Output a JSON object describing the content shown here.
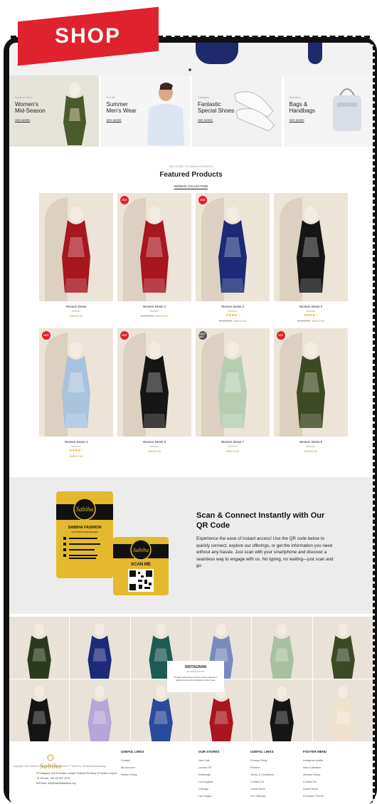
{
  "tag": {
    "label": "SHOP"
  },
  "categories": [
    {
      "subtitle": "Summer New",
      "title_l1": "Women's",
      "title_l2": "Mid-Season",
      "link": "SEE MORE"
    },
    {
      "subtitle": "Hot list",
      "title_l1": "Summer",
      "title_l2": "Men's Wear",
      "link": "SEE MORE"
    },
    {
      "subtitle": "Category",
      "title_l1": "Fantastic",
      "title_l2": "Special Shoes",
      "link": "SEE MORE"
    },
    {
      "subtitle": "Women's",
      "title_l1": "Bags &",
      "title_l2": "Handbags",
      "link": "SEE MORE"
    }
  ],
  "featured": {
    "welcome": "WELCOME TO SABIHA FASHION",
    "title": "Featured Products",
    "tab": "WOMAN COLLECTION"
  },
  "products": [
    {
      "name": "Women Dress",
      "category": "Women",
      "old_price": "",
      "price": "RM415.00",
      "stars": "",
      "badge": "",
      "color": "#a8161e"
    },
    {
      "name": "Women Dress 1",
      "category": "Women",
      "old_price": "RM510.00",
      "price": "RM415.00",
      "stars": "",
      "badge": "HOT",
      "color": "#a8161e"
    },
    {
      "name": "Women Dress 2",
      "category": "Women",
      "old_price": "RM510.00",
      "price": "RM415.00",
      "stars": "★★★★☆",
      "badge": "HOT",
      "color": "#1c2a78"
    },
    {
      "name": "Women Dress 3",
      "category": "Women",
      "old_price": "RM510.00",
      "price": "RM415.00",
      "stars": "★★★★☆",
      "badge": "",
      "color": "#151515"
    },
    {
      "name": "Women Dress 4",
      "category": "Women",
      "old_price": "",
      "price": "RM510.00",
      "stars": "★★★★☆",
      "badge": "HOT",
      "color": "#a9c2dd"
    },
    {
      "name": "Women Dress 6",
      "category": "Women",
      "old_price": "",
      "price": "RM415.00",
      "stars": "",
      "badge": "HOT",
      "color": "#151515"
    },
    {
      "name": "Women Dress 7",
      "category": "Women",
      "old_price": "",
      "price": "RM373.00",
      "stars": "",
      "badge": "SOLD OUT",
      "color": "#b6cdb2"
    },
    {
      "name": "Women Dress 8",
      "category": "Women",
      "old_price": "",
      "price": "RM438.00",
      "stars": "",
      "badge": "HOT",
      "color": "#3d4a24"
    }
  ],
  "qr": {
    "title": "Scan & Connect Instantly with Our QR Code",
    "text": "Experience the ease of instant access! Use the QR code below to quickly connect, explore our offerings, or get the information you need without any hassle. Just scan with your smartphone and discover a seamless way to engage with us. No typing, no waiting—just scan and go",
    "card_brand": "Sabiha",
    "card_name": "SABIHA FASHION",
    "card_sub": "CLOTHING WHOLESALER",
    "scan_label": "SCAN ME"
  },
  "instagram": {
    "title": "INSTAGRAM",
    "subtitle": "@SABIHAFASHION",
    "desc": "Porttitor adipiscing a volutus luctus parturient adipiscing lobortis vestibulum luctus risus."
  },
  "instagram_colors": [
    "#2b3a1c",
    "#1c2a78",
    "#1e5b55",
    "#7a8ac0",
    "#a8c0a0",
    "#3d4a24",
    "#151515",
    "#b5a6d8",
    "#2a4a9c",
    "#a8161e",
    "#151515",
    "#efe3d0"
  ],
  "footer": {
    "logo": "Sabiha",
    "address": "Putrajaya 15100 Kuala Lumpur Federal Territory of Kuala Lumpur",
    "phone": "Phone: +60 18 307 1270",
    "email": "Email: info@sabihafashion.my",
    "columns": [
      {
        "heading": "USEFUL LINKS",
        "items": [
          "Contact",
          "My Account",
          "Return Policy"
        ]
      },
      {
        "heading": "OUR STORES",
        "items": [
          "New York",
          "London SF",
          "Edinburgh",
          "Los Angeles",
          "Chicago",
          "Las Vegas"
        ]
      },
      {
        "heading": "USEFUL LINKS",
        "items": [
          "Privacy Policy",
          "Returns",
          "Terms & Conditions",
          "Contact Us",
          "Latest News",
          "Our Sitemap"
        ]
      },
      {
        "heading": "FOOTER MENU",
        "items": [
          "Instagram profile",
          "New Collection",
          "Woman Dress",
          "Contact Us",
          "Latest News",
          "Purchase Theme"
        ]
      }
    ]
  },
  "copyright": "Copyright 2024 Sabiha Fashion. All rights reserved. Theme by TheWebproMarketing"
}
